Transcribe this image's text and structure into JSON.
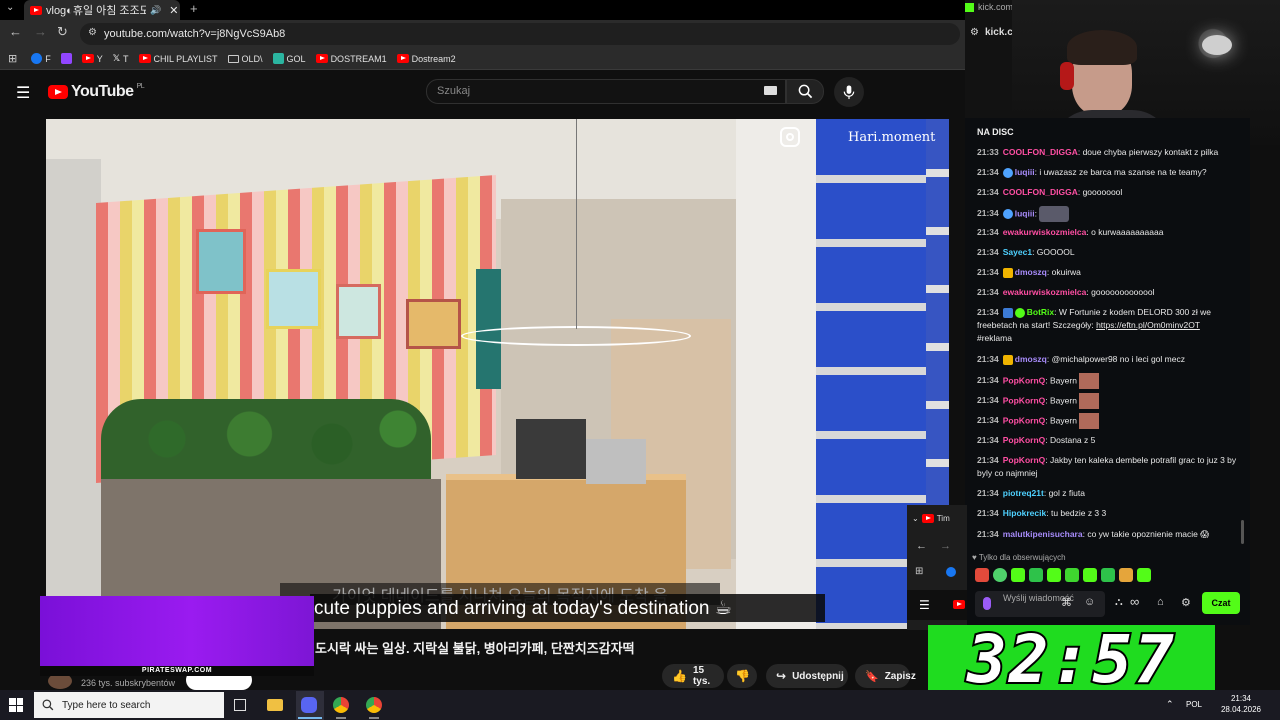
{
  "browser": {
    "tab_title": "vlog◐휴일 아침 조조모니",
    "url": "youtube.com/watch?v=j8NgVcS9Ab8",
    "bookmarks": [
      {
        "label": "F",
        "icon": "facebook-icon",
        "color": "#1877f2"
      },
      {
        "label": "",
        "icon": "twitch-icon",
        "color": "#9146ff"
      },
      {
        "label": "Y",
        "icon": "youtube-icon",
        "color": "#ff0000"
      },
      {
        "label": "T",
        "icon": "x-icon",
        "color": "#ffffff"
      },
      {
        "label": "CHIL PLAYLIST",
        "icon": "youtube-icon",
        "color": "#ff0000"
      },
      {
        "label": "OLD\\",
        "icon": "folder-icon",
        "color": "#cccccc"
      },
      {
        "label": "GOL",
        "icon": "gol-icon",
        "color": "#2bb5a0"
      },
      {
        "label": "DOSTREAM1",
        "icon": "youtube-icon",
        "color": "#ff0000"
      },
      {
        "label": "Dostream2",
        "icon": "youtube-icon",
        "color": "#ff0000"
      }
    ]
  },
  "youtube": {
    "logo_text": "YouTube",
    "region": "PL",
    "search_placeholder": "Szukaj",
    "subtitle_faded": "가이엇 데네이드를 지나쳐 오늘의 목적지에 도착 음",
    "subtitle": "cute puppies and arriving at today's destination ☕",
    "watermark": "Hari.moment",
    "video_title": "도시락 싸는 일상. 지락실 불닭, 병아리카페, 단짠치즈감자떡",
    "subscribers": "236 tys. subskrybentów",
    "likes": "15 tys.",
    "share_label": "Udostępnij",
    "save_label": "Zapisz"
  },
  "ad": {
    "banner_text": "PIRATESWAP.COM"
  },
  "kick": {
    "tab_text": "kick.com",
    "url_text": "kick.c",
    "chat_header": "NA DISC",
    "messages": [
      {
        "time": "21:33",
        "user": "COOLFON_DIGGA",
        "color": "#ff4fa3",
        "text": "doue chyba pierwszy kontakt z pilka"
      },
      {
        "time": "21:34",
        "user": "luqiii",
        "color": "#a78bfa",
        "text": "i uwazasz ze barca ma szanse na te teamy?"
      },
      {
        "time": "21:34",
        "user": "COOLFON_DIGGA",
        "color": "#ff4fa3",
        "text": "goooooool"
      },
      {
        "time": "21:34",
        "user": "luqiii",
        "color": "#a78bfa",
        "text": ""
      },
      {
        "time": "21:34",
        "user": "ewakurwiskozmielca",
        "color": "#ff4fa3",
        "text": "o kurwaaaaaaaaaa"
      },
      {
        "time": "21:34",
        "user": "Sayec1",
        "color": "#4fd1ff",
        "text": "GOOOOL"
      },
      {
        "time": "21:34",
        "user": "dmoszq",
        "color": "#a78bfa",
        "text": "okuirwa"
      },
      {
        "time": "21:34",
        "user": "ewakurwiskozmielca",
        "color": "#ff4fa3",
        "text": "gooooooooooool"
      },
      {
        "time": "21:34",
        "user": "BotRix",
        "color": "#53fc18",
        "text": "W Fortunie z kodem DELORD 300 zł we freebetach na start! Szczegóły:",
        "link": "https://eftn.pl/Om0minv2OT",
        "extra": "#reklama"
      },
      {
        "time": "21:34",
        "user": "dmoszq",
        "color": "#a78bfa",
        "text": "@michalpower98 no i leci gol mecz"
      },
      {
        "time": "21:34",
        "user": "PopKornQ",
        "color": "#ff4fa3",
        "text": "Bayern"
      },
      {
        "time": "21:34",
        "user": "PopKornQ",
        "color": "#ff4fa3",
        "text": "Bayern"
      },
      {
        "time": "21:34",
        "user": "PopKornQ",
        "color": "#ff4fa3",
        "text": "Bayern"
      },
      {
        "time": "21:34",
        "user": "PopKornQ",
        "color": "#ff4fa3",
        "text": "Dostana z 5"
      },
      {
        "time": "21:34",
        "user": "PopKornQ",
        "color": "#ff4fa3",
        "text": "Jakby ten kaleka dembele potrafil grac to juz 3 by byly co najmniej"
      },
      {
        "time": "21:34",
        "user": "piotreq21t",
        "color": "#4fd1ff",
        "text": "gol z fiuta"
      },
      {
        "time": "21:34",
        "user": "Hipokrecik",
        "color": "#4fd1ff",
        "text": "tu bedzie z 3 3"
      },
      {
        "time": "21:34",
        "user": "malutkipenisuchara",
        "color": "#a78bfa",
        "text": "co yw takie opoznienie macie 😱"
      }
    ],
    "followers_only": "Tylko dla obserwujących",
    "input_placeholder": "Wyślij wiadomość",
    "chat_button": "Czat"
  },
  "mini_window": {
    "tab_text": "Tim"
  },
  "timer": {
    "value": "32:57"
  },
  "taskbar": {
    "search_placeholder": "Type here to search",
    "language": "POL",
    "time": "21:34",
    "date": "28.04.2026"
  }
}
